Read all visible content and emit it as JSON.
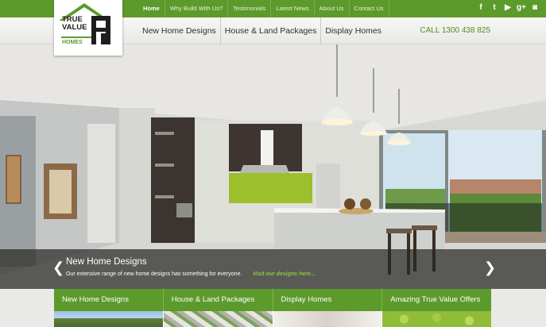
{
  "logo": {
    "line1": "TRUE",
    "line2": "VALUE",
    "line3": "HOMES"
  },
  "top_nav": [
    {
      "label": "Home",
      "active": true
    },
    {
      "label": "Why Build With Us?",
      "active": false
    },
    {
      "label": "Testimonials",
      "active": false
    },
    {
      "label": "Latest News",
      "active": false
    },
    {
      "label": "About Us",
      "active": false
    },
    {
      "label": "Contact Us",
      "active": false
    }
  ],
  "social": [
    {
      "icon": "facebook-icon",
      "glyph": "f"
    },
    {
      "icon": "twitter-icon",
      "glyph": "t"
    },
    {
      "icon": "youtube-icon",
      "glyph": "▶"
    },
    {
      "icon": "google-plus-icon",
      "glyph": "g+"
    },
    {
      "icon": "instagram-icon",
      "glyph": "◙"
    }
  ],
  "main_nav": [
    {
      "label": "New Home Designs"
    },
    {
      "label": "House & Land Packages"
    },
    {
      "label": "Display Homes"
    }
  ],
  "phone": "CALL 1300 438 825",
  "slider": {
    "title": "New Home Designs",
    "text": "Our extensive range of new home designs has something for everyone.",
    "link": "Visit our designs here...",
    "prev_glyph": "❮",
    "next_glyph": "❯"
  },
  "tabs": [
    {
      "label": "New Home Designs"
    },
    {
      "label": "House & Land Packages"
    },
    {
      "label": "Display Homes"
    },
    {
      "label": "Amazing True Value Offers"
    }
  ],
  "colors": {
    "brand_green": "#5c9a2c",
    "accent_green": "#8cc63f"
  }
}
